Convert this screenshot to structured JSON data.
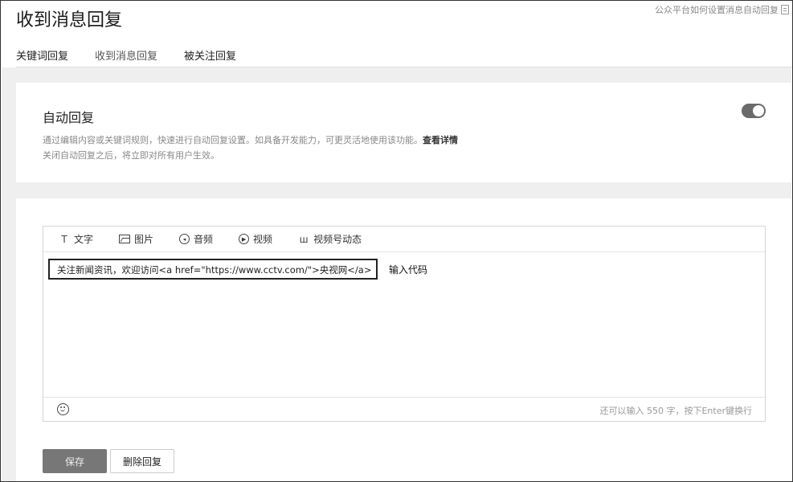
{
  "header": {
    "title": "收到消息回复",
    "help_link": "公众平台如何设置消息自动回复"
  },
  "tabs": [
    {
      "label": "关键词回复",
      "active": false
    },
    {
      "label": "收到消息回复",
      "active": true
    },
    {
      "label": "被关注回复",
      "active": false
    }
  ],
  "auto_reply": {
    "title": "自动回复",
    "desc_line1": "通过编辑内容或关键词规则，快速进行自动回复设置。如具备开发能力，可更灵活地使用该功能。",
    "detail_link": "查看详情",
    "desc_line2": "关闭自动回复之后，将立即对所有用户生效。",
    "enabled": true
  },
  "editor": {
    "toolbar": [
      {
        "label": "文字",
        "icon": "text-icon"
      },
      {
        "label": "图片",
        "icon": "image-icon"
      },
      {
        "label": "音频",
        "icon": "audio-icon"
      },
      {
        "label": "视频",
        "icon": "video-icon"
      },
      {
        "label": "视频号动态",
        "icon": "channels-icon"
      }
    ],
    "content": "关注新闻资讯，欢迎访问<a href=\"https://www.cctv.com/\">央视网</a>",
    "annotation": "输入代码",
    "counter": "还可以输入 550 字，按下Enter键换行"
  },
  "actions": {
    "save_label": "保存",
    "delete_label": "删除回复"
  }
}
